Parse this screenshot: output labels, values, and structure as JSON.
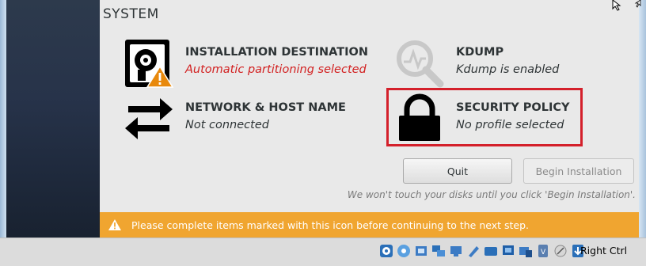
{
  "hub": {
    "section_title": "SYSTEM",
    "spokes": [
      {
        "id": "installation-destination",
        "title": "INSTALLATION DESTINATION",
        "status": "Automatic partitioning selected",
        "warning": true,
        "icon": "hard-disk-icon"
      },
      {
        "id": "network-host-name",
        "title": "NETWORK & HOST NAME",
        "status": "Not connected",
        "warning": false,
        "icon": "network-arrows-icon"
      },
      {
        "id": "kdump",
        "title": "KDUMP",
        "status": "Kdump is enabled",
        "warning": false,
        "icon": "kdump-magnifier-icon"
      },
      {
        "id": "security-policy",
        "title": "SECURITY POLICY",
        "status": "No profile selected",
        "warning": false,
        "icon": "padlock-icon"
      }
    ],
    "quit_label": "Quit",
    "begin_label": "Begin Installation",
    "hint": "We won't touch your disks until you click 'Begin Installation'."
  },
  "warning_bar": {
    "text": "Please complete items marked with this icon before continuing to the next step."
  },
  "statusbar": {
    "host_key": "Right Ctrl",
    "icons": [
      "optical-drive-icon",
      "hard-disk-activity-icon",
      "usb-icon",
      "network-icon",
      "shared-folders-icon",
      "display-icon",
      "screen-recording-icon",
      "cpu-icon",
      "vm-icon",
      "mouse-integration-icon",
      "download-arrow-icon"
    ]
  },
  "colors": {
    "warning_text": "#d21f1f",
    "warning_bar": "#f0a530",
    "highlight_border": "#d4202b",
    "sidebar": "#2d3a4c"
  }
}
